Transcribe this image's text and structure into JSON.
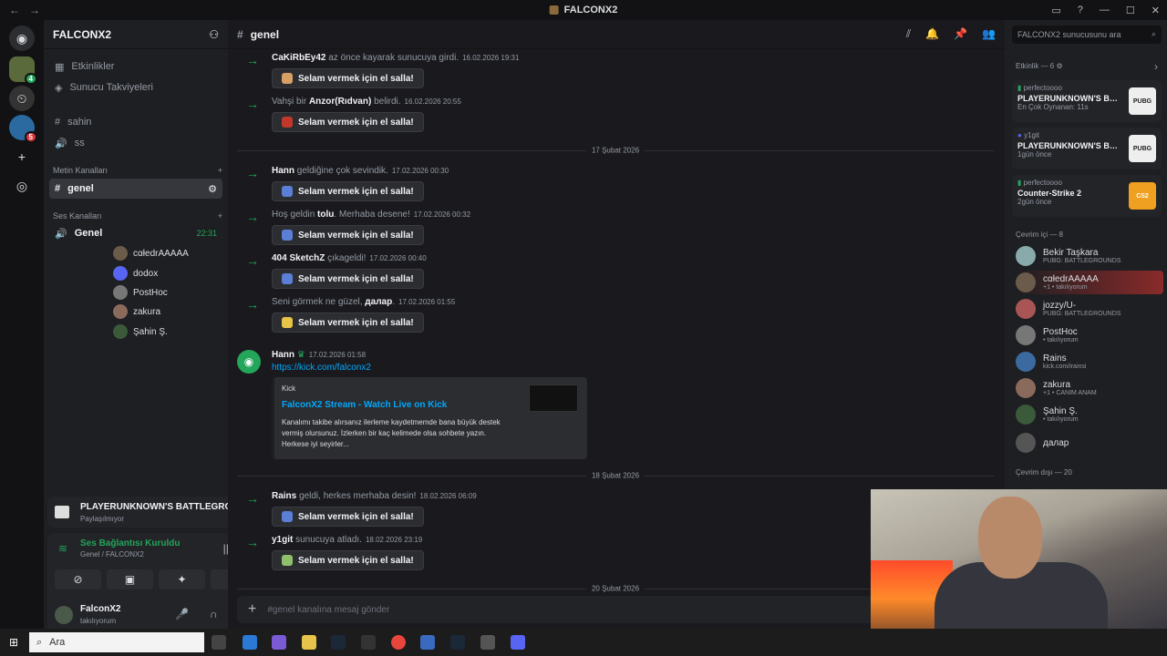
{
  "window": {
    "title": "FALCONX2"
  },
  "server": {
    "name": "FALCONX2",
    "events": "Etkinlikler",
    "boosts": "Sunucu Takviyeleri",
    "pre_channels": [
      {
        "icon": "#",
        "name": "sahin"
      },
      {
        "icon": "🔊",
        "name": "ss"
      }
    ],
    "text_category": "Metin Kanalları",
    "active_channel": "genel",
    "voice_category": "Ses Kanalları",
    "voice_channel": "Genel",
    "voice_time": "22:31",
    "voice_users": [
      {
        "name": "cαłedrΑΑΑΑΑ",
        "color": "#6b5b4b"
      },
      {
        "name": "dodox",
        "color": "#5865f2"
      },
      {
        "name": "PostHoc",
        "color": "#777"
      },
      {
        "name": "zakura",
        "color": "#8a6a5a"
      },
      {
        "name": "Şahin Ş.",
        "color": "#3a5a3a"
      }
    ]
  },
  "activity": {
    "game": "PLAYERUNKNOWN'S BATTLEGRO...",
    "status": "Paylaşılmıyor"
  },
  "voice": {
    "status": "Ses Bağlantısı Kuruldu",
    "channel": "Genel / FALCONX2"
  },
  "user": {
    "name": "FalconX2",
    "status": "takılıyorum"
  },
  "chat": {
    "channel": "genel",
    "placeholder": "#genel kanalına mesaj gönder",
    "wave": "Selam vermek için el salla!",
    "messages": [
      {
        "pre": "",
        "name": "CaKiRbEy42",
        "post": " az önce kayarak sunucuya girdi.",
        "ts": "16.02.2026 19:31"
      },
      {
        "pre": "Vahşi bir ",
        "name": "Anzor(Rıdvan)",
        "post": " belirdi.",
        "ts": "16.02.2026 20:55"
      },
      {
        "pre": "",
        "name": "Hann",
        "post": " geldiğine çok sevindik.",
        "ts": "17.02.2026 00:30"
      },
      {
        "pre": "Hoş geldin ",
        "name": "tolu",
        "post": ". Merhaba desene!",
        "ts": "17.02.2026 00:32"
      },
      {
        "pre": "",
        "name": "404 SketchZ",
        "post": " çıkageldi!",
        "ts": "17.02.2026 00:40"
      },
      {
        "pre": "Seni görmek ne güzel, ",
        "name": "далар",
        "post": ".",
        "ts": "17.02.2026 01:55"
      },
      {
        "pre": "",
        "name": "Rains",
        "post": " geldi, herkes merhaba desin!",
        "ts": "18.02.2026 06:09"
      },
      {
        "pre": "",
        "name": "y1git",
        "post": " sunucuya atladı.",
        "ts": "18.02.2026 23:19"
      }
    ],
    "dates": [
      "17 Şubat 2026",
      "18 Şubat 2026",
      "20 Şubat 2026"
    ],
    "post": {
      "name": "Hann",
      "ts": "17.02.2026 01:58",
      "link": "https://kick.com/falconx2",
      "embed_site": "Kick",
      "embed_title": "FalconX2 Stream - Watch Live on Kick",
      "embed_desc": "Kanalımı takibe alırsanız ilerleme kaydetmemde bana büyük destek vermiş olursunuz. İzlerken bir kaç kelimede olsa sohbete yazın. Herkese iyi seyirler..."
    }
  },
  "members": {
    "search": "FALCONX2 sunucusunu ara",
    "activity_header": "Etkinlik — 6",
    "activities": [
      {
        "user": "perfectoooo",
        "game": "PLAYERUNKNOWN'S BAT...",
        "sub": "En Çok Oynanan: 11s",
        "logo": "PUBG"
      },
      {
        "user": "y1git",
        "game": "PLAYERUNKNOWN'S BAT...",
        "sub": "1gün önce",
        "logo": "PUBG"
      },
      {
        "user": "perfectoooo",
        "game": "Counter-Strike 2",
        "sub": "2gün önce",
        "logo": "CS2"
      }
    ],
    "online_header": "Çevrim içi — 8",
    "online": [
      {
        "name": "Bekir Taşkara",
        "status": "PUBG: BATTLEGROUNDS",
        "color": "#8aa"
      },
      {
        "name": "cαłedrΑΑΑΑΑ",
        "status": "+1 • takılıyorum",
        "color": "#6b5b4b"
      },
      {
        "name": "jozzy/U-",
        "status": "PUBG: BATTLEGROUNDS",
        "color": "#a55"
      },
      {
        "name": "PostHoc",
        "status": "• takılıyorum",
        "color": "#777"
      },
      {
        "name": "Rains",
        "status": "kick.com/irainsi",
        "color": "#3b6aa0"
      },
      {
        "name": "zakura",
        "status": "+1 • CANIM ANAM",
        "color": "#8a6a5a"
      },
      {
        "name": "Şahin Ş.",
        "status": "• takılıyorum",
        "color": "#3a5a3a"
      },
      {
        "name": "далар",
        "status": "",
        "color": "#555"
      }
    ],
    "offline_header": "Çevrim dışı — 20"
  },
  "taskbar": {
    "search": "Ara"
  }
}
